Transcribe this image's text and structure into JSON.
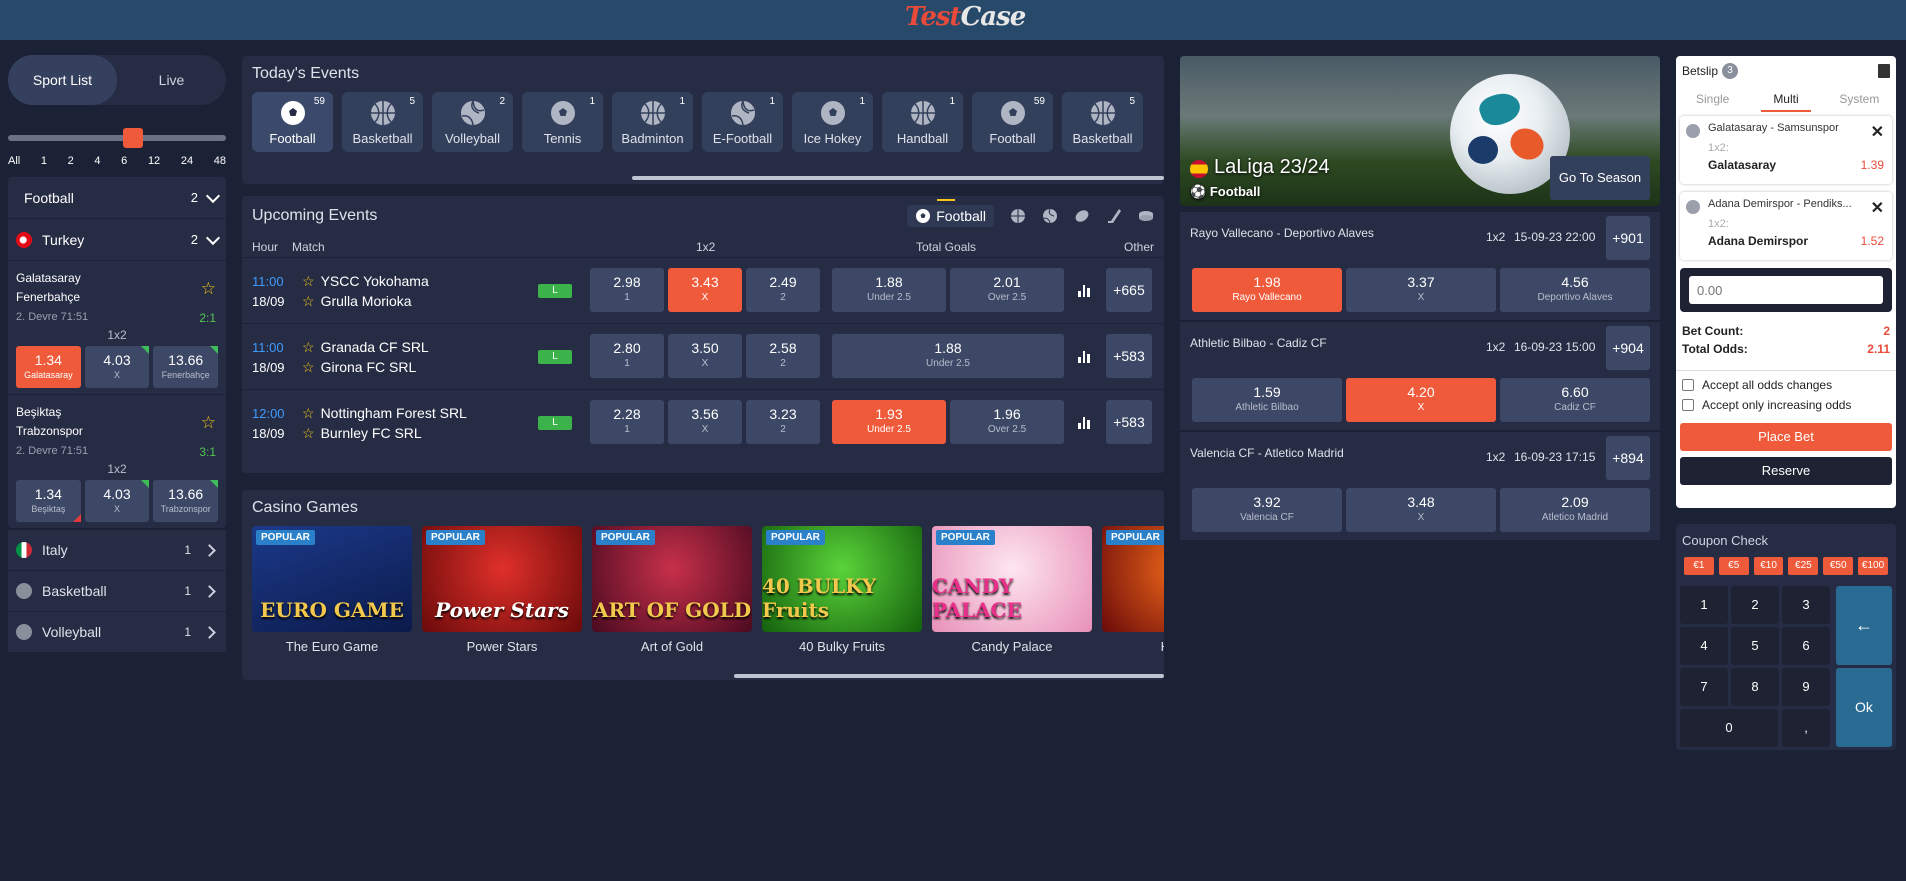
{
  "header": {
    "logo_text_1": "Test",
    "logo_text_2": "Case"
  },
  "left": {
    "tabs": [
      "Sport List",
      "Live"
    ],
    "slider_ticks": [
      "All",
      "1",
      "2",
      "4",
      "6",
      "12",
      "24",
      "48"
    ],
    "sport": {
      "name": "Football",
      "count": "2"
    },
    "country": {
      "name": "Turkey",
      "count": "2"
    },
    "matches": [
      {
        "team1": "Galatasaray",
        "team2": "Fenerbahçe",
        "time": "2. Devre 71:51",
        "score": "2:1",
        "market": "1x2",
        "odds": [
          {
            "v": "1.34",
            "l": "Galatasaray"
          },
          {
            "v": "4.03",
            "l": "X"
          },
          {
            "v": "13.66",
            "l": "Fenerbahçe"
          }
        ]
      },
      {
        "team1": "Beşiktaş",
        "team2": "Trabzonspor",
        "time": "2. Devre 71:51",
        "score": "3:1",
        "market": "1x2",
        "odds": [
          {
            "v": "1.34",
            "l": "Beşiktaş"
          },
          {
            "v": "4.03",
            "l": "X"
          },
          {
            "v": "13.66",
            "l": "Trabzonspor"
          }
        ]
      }
    ],
    "categories": [
      {
        "name": "Italy",
        "count": "1"
      },
      {
        "name": "Basketball",
        "count": "1"
      },
      {
        "name": "Volleyball",
        "count": "1"
      }
    ]
  },
  "today": {
    "title": "Today's Events",
    "tiles": [
      {
        "name": "Football",
        "count": "59"
      },
      {
        "name": "Basketball",
        "count": "5"
      },
      {
        "name": "Volleyball",
        "count": "2"
      },
      {
        "name": "Tennis",
        "count": "1"
      },
      {
        "name": "Badminton",
        "count": "1"
      },
      {
        "name": "E-Football",
        "count": "1"
      },
      {
        "name": "Ice Hokey",
        "count": "1"
      },
      {
        "name": "Handball",
        "count": "1"
      },
      {
        "name": "Football",
        "count": "59"
      },
      {
        "name": "Basketball",
        "count": "5"
      }
    ]
  },
  "upcoming": {
    "title": "Upcoming Events",
    "active_tab": "Football",
    "cols": {
      "hour": "Hour",
      "match": "Match",
      "m1": "1x2",
      "m2": "Total Goals",
      "other": "Other"
    },
    "live_label": "L",
    "rows": [
      {
        "hour": "11:00",
        "date": "18/09",
        "t1": "YSCC Yokohama",
        "t2": "Grulla Morioka",
        "o1": {
          "v": "2.98",
          "l": "1"
        },
        "ox": {
          "v": "3.43",
          "l": "X"
        },
        "o2": {
          "v": "2.49",
          "l": "2"
        },
        "u": {
          "v": "1.88",
          "l": "Under 2.5"
        },
        "ov": {
          "v": "2.01",
          "l": "Over 2.5"
        },
        "more": "+665"
      },
      {
        "hour": "11:00",
        "date": "18/09",
        "t1": "Granada CF SRL",
        "t2": "Girona FC SRL",
        "o1": {
          "v": "2.80",
          "l": "1"
        },
        "ox": {
          "v": "3.50",
          "l": "X"
        },
        "o2": {
          "v": "2.58",
          "l": "2"
        },
        "u": {
          "v": "1.88",
          "l": "Under 2.5"
        },
        "more": "+583"
      },
      {
        "hour": "12:00",
        "date": "18/09",
        "t1": "Nottingham Forest SRL",
        "t2": "Burnley FC SRL",
        "o1": {
          "v": "2.28",
          "l": "1"
        },
        "ox": {
          "v": "3.56",
          "l": "X"
        },
        "o2": {
          "v": "3.23",
          "l": "2"
        },
        "u": {
          "v": "1.93",
          "l": "Under 2.5"
        },
        "ov": {
          "v": "1.96",
          "l": "Over 2.5"
        },
        "more": "+583"
      }
    ]
  },
  "casino": {
    "title": "Casino Games",
    "popular_label": "POPULAR",
    "games": [
      {
        "name": "The Euro Game",
        "art": "EURO GAME",
        "color": "#1b2b6a"
      },
      {
        "name": "Power Stars",
        "art": "Power Stars",
        "color": "#a01818"
      },
      {
        "name": "Art of Gold",
        "art": "ART OF GOLD",
        "color": "#6a1030"
      },
      {
        "name": "40 Bulky Fruits",
        "art": "40 BULKY Fruits",
        "color": "#2a8a2a"
      },
      {
        "name": "Candy Palace",
        "art": "CANDY PALACE",
        "color": "#e8a8c8"
      },
      {
        "name": "Hot Slo",
        "art": "HO",
        "color": "#b81a10"
      }
    ]
  },
  "laliga": {
    "title": "LaLiga 23/24",
    "sport": "Football",
    "button": "Go To Season",
    "events": [
      {
        "match": "Rayo Vallecano - Deportivo Alaves",
        "market": "1x2",
        "date": "15-09-23 22:00",
        "more": "+901",
        "odds": [
          {
            "v": "1.98",
            "l": "Rayo Vallecano"
          },
          {
            "v": "3.37",
            "l": "X"
          },
          {
            "v": "4.56",
            "l": "Deportivo Alaves"
          }
        ]
      },
      {
        "match": "Athletic Bilbao - Cadiz CF",
        "market": "1x2",
        "date": "16-09-23 15:00",
        "more": "+904",
        "odds": [
          {
            "v": "1.59",
            "l": "Athletic Bilbao"
          },
          {
            "v": "4.20",
            "l": "X"
          },
          {
            "v": "6.60",
            "l": "Cadiz CF"
          }
        ]
      },
      {
        "match": "Valencia CF - Atletico Madrid",
        "market": "1x2",
        "date": "16-09-23 17:15",
        "more": "+894",
        "odds": [
          {
            "v": "3.92",
            "l": "Valencia CF"
          },
          {
            "v": "3.48",
            "l": "X"
          },
          {
            "v": "2.09",
            "l": "Atletico Madrid"
          }
        ]
      }
    ]
  },
  "betslip": {
    "title": "Betslip",
    "count": "3",
    "tabs": [
      "Single",
      "Multi",
      "System"
    ],
    "items": [
      {
        "match": "Galatasaray - Samsunspor",
        "market": "1x2:",
        "selection": "Galatasaray",
        "odd": "1.39"
      },
      {
        "match": "Adana Demirspor - Pendiks...",
        "market": "1x2:",
        "selection": "Adana Demirspor",
        "odd": "1.52"
      }
    ],
    "stake_placeholder": "0.00",
    "bet_count_label": "Bet Count:",
    "bet_count": "2",
    "total_odds_label": "Total Odds:",
    "total_odds": "2.11",
    "accept_all": "Accept all odds changes",
    "accept_increasing": "Accept only increasing odds",
    "place_bet": "Place Bet",
    "reserve": "Reserve"
  },
  "coupon": {
    "title": "Coupon Check",
    "amounts": [
      "€1",
      "€5",
      "€10",
      "€25",
      "€50",
      "€100"
    ],
    "keys": [
      "1",
      "2",
      "3",
      "4",
      "5",
      "6",
      "7",
      "8",
      "9",
      "0",
      ",",
      "←",
      "Ok"
    ]
  }
}
